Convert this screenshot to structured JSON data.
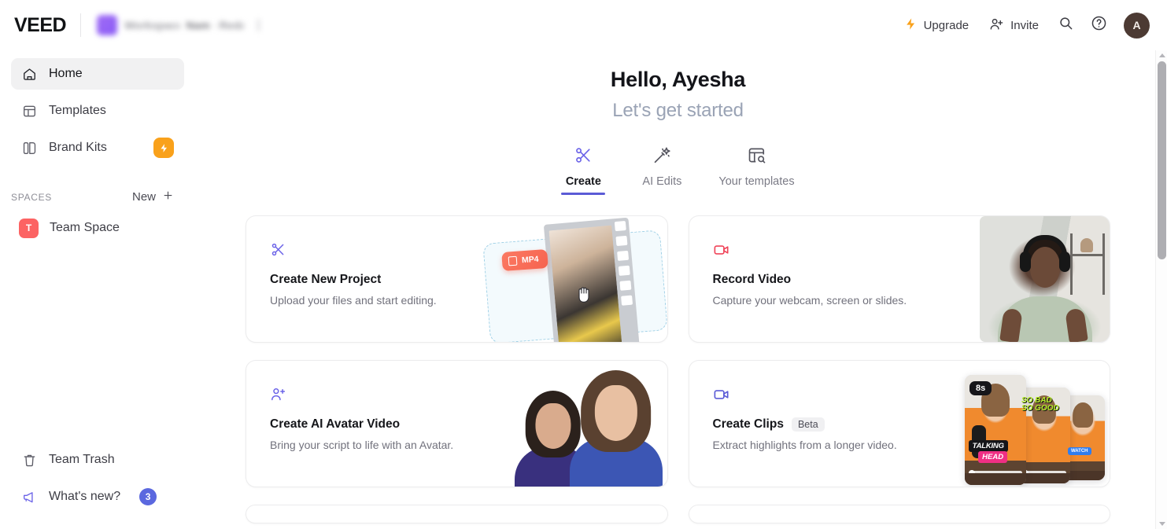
{
  "header": {
    "logo": "VEED",
    "workspace_name": "Workspace Name Redacted",
    "upgrade_label": "Upgrade",
    "invite_label": "Invite",
    "avatar_initial": "A"
  },
  "sidebar": {
    "items": [
      {
        "label": "Home",
        "icon": "home-icon",
        "active": true
      },
      {
        "label": "Templates",
        "icon": "templates-icon",
        "active": false
      },
      {
        "label": "Brand Kits",
        "icon": "brand-kits-icon",
        "active": false,
        "badge": "bolt"
      }
    ],
    "spaces_label": "SPACES",
    "new_label": "New",
    "spaces": [
      {
        "label": "Team Space",
        "initial": "T"
      }
    ],
    "bottom": [
      {
        "label": "Team Trash",
        "icon": "trash-icon"
      },
      {
        "label": "What's new?",
        "icon": "megaphone-icon",
        "count": "3"
      }
    ]
  },
  "main": {
    "greeting": "Hello, Ayesha",
    "subgreeting": "Let's get started",
    "tabs": [
      {
        "label": "Create",
        "icon": "scissors-icon",
        "active": true
      },
      {
        "label": "AI Edits",
        "icon": "magic-wand-icon",
        "active": false
      },
      {
        "label": "Your templates",
        "icon": "template-search-icon",
        "active": false
      }
    ],
    "cards": [
      {
        "title": "Create New Project",
        "subtitle": "Upload your files and start editing.",
        "icon": "scissors-icon",
        "badge": "",
        "art_label": "MP4"
      },
      {
        "title": "Record Video",
        "subtitle": "Capture your webcam, screen or slides.",
        "icon": "video-camera-icon",
        "badge": ""
      },
      {
        "title": "Create AI Avatar Video",
        "subtitle": "Bring your script to life with an Avatar.",
        "icon": "person-plus-icon",
        "badge": ""
      },
      {
        "title": "Create Clips",
        "subtitle": "Extract highlights from a longer video.",
        "icon": "video-camera-icon",
        "badge": "Beta",
        "art_duration": "8s",
        "art_caption_1": "TALKING",
        "art_caption_2": "HEAD",
        "art_caption_3": "SO BAD",
        "art_caption_4": "SO GOOD"
      }
    ]
  },
  "colors": {
    "accent": "#5b5bd6",
    "upgrade": "#f9a11b",
    "record": "#f0455a",
    "space": "#fc6363",
    "badge": "#5b68df"
  }
}
